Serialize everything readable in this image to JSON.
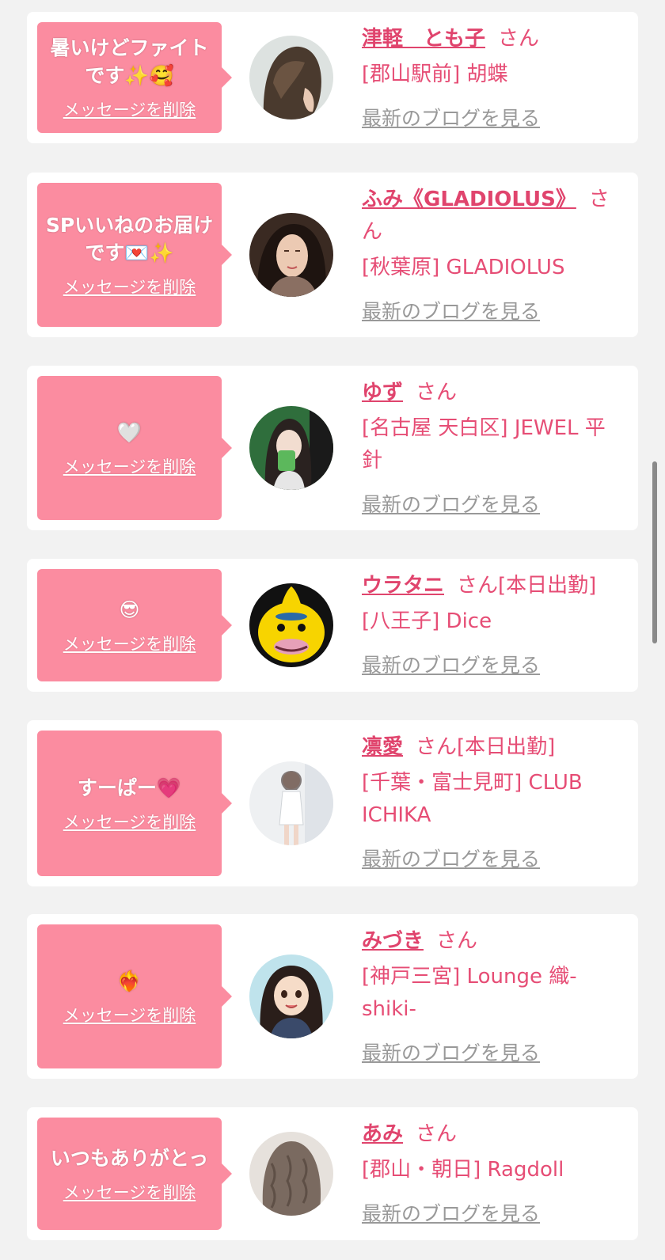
{
  "items": [
    {
      "message": "暑いけどファイトです✨🥰",
      "delete_label": "メッセージを削除",
      "name": "津軽　とも子",
      "san": "さん",
      "shift": "",
      "shop": "[郡山駅前] 胡蝶",
      "blog_label": "最新のブログを見る"
    },
    {
      "message": "SPいいねのお届けです💌✨",
      "delete_label": "メッセージを削除",
      "name": "ふみ《GLADIOLUS》",
      "san": "さん",
      "shift": "",
      "shop": "[秋葉原] GLADIOLUS",
      "blog_label": "最新のブログを見る"
    },
    {
      "message": "🤍",
      "delete_label": "メッセージを削除",
      "name": "ゆず",
      "san": "さん",
      "shift": "",
      "shop": "[名古屋 天白区] JEWEL 平針",
      "blog_label": "最新のブログを見る"
    },
    {
      "message": "😎",
      "delete_label": "メッセージを削除",
      "name": "ウラタニ",
      "san": "さん",
      "shift": "[本日出勤]",
      "shop": "[八王子] Dice",
      "blog_label": "最新のブログを見る"
    },
    {
      "message": "すーぱー💗",
      "delete_label": "メッセージを削除",
      "name": "凛愛",
      "san": "さん",
      "shift": "[本日出勤]",
      "shop": "[千葉・富士見町] CLUB ICHIKA",
      "blog_label": "最新のブログを見る"
    },
    {
      "message": "❤️‍🔥",
      "delete_label": "メッセージを削除",
      "name": "みづき",
      "san": "さん",
      "shift": "",
      "shop": "[神戸三宮] Lounge 織-shiki-",
      "blog_label": "最新のブログを見る"
    },
    {
      "message": "いつもありがとっ",
      "delete_label": "メッセージを削除",
      "name": "あみ",
      "san": "さん",
      "shift": "",
      "shop": "[郡山・朝日] Ragdoll",
      "blog_label": "最新のブログを見る"
    }
  ],
  "colors": {
    "bubble": "#fb8ca0",
    "accent": "#e0446d",
    "link_gray": "#999999",
    "background": "#f2f2f2"
  }
}
